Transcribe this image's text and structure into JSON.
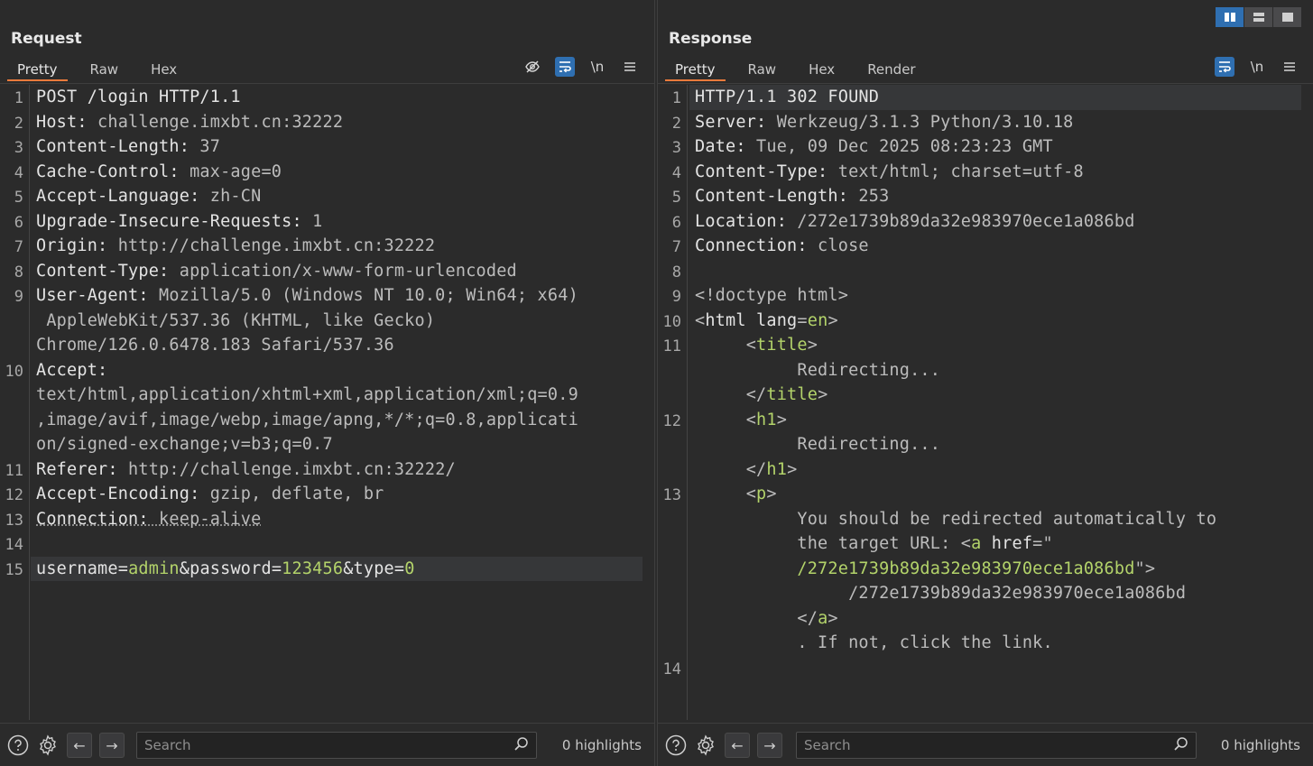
{
  "request": {
    "title": "Request",
    "tabs": [
      "Pretty",
      "Raw",
      "Hex"
    ],
    "tools": [
      "eye-slash-icon",
      "wrap-icon",
      "\\n",
      "menu-icon"
    ],
    "lines": [
      {
        "n": "1",
        "segs": [
          [
            "POST /login HTTP/1.1",
            "k"
          ]
        ]
      },
      {
        "n": "2",
        "segs": [
          [
            "Host:",
            "k"
          ],
          [
            " challenge.imxbt.cn:32222",
            "v"
          ]
        ]
      },
      {
        "n": "3",
        "segs": [
          [
            "Content-Length:",
            "k"
          ],
          [
            " 37",
            "v"
          ]
        ]
      },
      {
        "n": "4",
        "segs": [
          [
            "Cache-Control:",
            "k"
          ],
          [
            " max-age=0",
            "v"
          ]
        ]
      },
      {
        "n": "5",
        "segs": [
          [
            "Accept-Language:",
            "k"
          ],
          [
            " zh-CN",
            "v"
          ]
        ]
      },
      {
        "n": "6",
        "segs": [
          [
            "Upgrade-Insecure-Requests:",
            "k"
          ],
          [
            " 1",
            "v"
          ]
        ]
      },
      {
        "n": "7",
        "segs": [
          [
            "Origin:",
            "k"
          ],
          [
            " http://challenge.imxbt.cn:32222",
            "v"
          ]
        ]
      },
      {
        "n": "8",
        "segs": [
          [
            "Content-Type:",
            "k"
          ],
          [
            " application/x-www-form-urlencoded",
            "v"
          ]
        ]
      },
      {
        "n": "9",
        "segs": [
          [
            "User-Agent:",
            "k"
          ],
          [
            " Mozilla/5.0 (Windows NT 10.0; Win64; x64)",
            "v"
          ]
        ]
      },
      {
        "n": "",
        "segs": [
          [
            " AppleWebKit/537.36 (KHTML, like Gecko)",
            "v"
          ]
        ]
      },
      {
        "n": "",
        "segs": [
          [
            "Chrome/126.0.6478.183 Safari/537.36",
            "v"
          ]
        ]
      },
      {
        "n": "10",
        "segs": [
          [
            "Accept:",
            "k"
          ]
        ]
      },
      {
        "n": "",
        "segs": [
          [
            "text/html,application/xhtml+xml,application/xml;q=0.9",
            "v"
          ]
        ]
      },
      {
        "n": "",
        "segs": [
          [
            ",image/avif,image/webp,image/apng,*/*;q=0.8,applicati",
            "v"
          ]
        ]
      },
      {
        "n": "",
        "segs": [
          [
            "on/signed-exchange;v=b3;q=0.7",
            "v"
          ]
        ]
      },
      {
        "n": "11",
        "segs": [
          [
            "Referer:",
            "k"
          ],
          [
            " http://challenge.imxbt.cn:32222/",
            "v"
          ]
        ]
      },
      {
        "n": "12",
        "segs": [
          [
            "Accept-Encoding:",
            "k"
          ],
          [
            " gzip, deflate, br",
            "v"
          ]
        ]
      },
      {
        "n": "13",
        "segs": [
          [
            "Connection:",
            "k dot"
          ],
          [
            " keep-alive",
            "v dot"
          ]
        ]
      },
      {
        "n": "14",
        "segs": []
      },
      {
        "n": "15",
        "hl": true,
        "segs": [
          [
            "username",
            "k"
          ],
          [
            "=",
            "k"
          ],
          [
            "admin",
            "g"
          ],
          [
            "&",
            "k"
          ],
          [
            "password",
            "k"
          ],
          [
            "=",
            "k"
          ],
          [
            "123456",
            "g"
          ],
          [
            "&",
            "k"
          ],
          [
            "type",
            "k"
          ],
          [
            "=",
            "k"
          ],
          [
            "0",
            "g"
          ]
        ]
      }
    ],
    "search_placeholder": "Search",
    "highlights": "0 highlights"
  },
  "response": {
    "title": "Response",
    "tabs": [
      "Pretty",
      "Raw",
      "Hex",
      "Render"
    ],
    "tools": [
      "wrap-icon",
      "\\n",
      "menu-icon"
    ],
    "lines": [
      {
        "n": "1",
        "hl": true,
        "segs": [
          [
            "HTTP/1.1 302 FOUND",
            "k"
          ]
        ]
      },
      {
        "n": "2",
        "segs": [
          [
            "Server:",
            "k"
          ],
          [
            " Werkzeug/3.1.3 Python/3.10.18",
            "v"
          ]
        ]
      },
      {
        "n": "3",
        "segs": [
          [
            "Date:",
            "k"
          ],
          [
            " Tue, 09 Dec 2025 08:23:23 GMT",
            "v"
          ]
        ]
      },
      {
        "n": "4",
        "segs": [
          [
            "Content-Type:",
            "k"
          ],
          [
            " text/html; charset=utf-8",
            "v"
          ]
        ]
      },
      {
        "n": "5",
        "segs": [
          [
            "Content-Length:",
            "k"
          ],
          [
            " 253",
            "v"
          ]
        ]
      },
      {
        "n": "6",
        "segs": [
          [
            "Location:",
            "k"
          ],
          [
            " /272e1739b89da32e983970ece1a086bd",
            "v"
          ]
        ]
      },
      {
        "n": "7",
        "segs": [
          [
            "Connection:",
            "k"
          ],
          [
            " close",
            "v"
          ]
        ]
      },
      {
        "n": "8",
        "segs": []
      },
      {
        "n": "9",
        "segs": [
          [
            "<!doctype html>",
            "v"
          ]
        ]
      },
      {
        "n": "10",
        "segs": [
          [
            "<",
            "v"
          ],
          [
            "html",
            "k"
          ],
          [
            " lang",
            "k"
          ],
          [
            "=",
            "v"
          ],
          [
            "en",
            "g"
          ],
          [
            ">",
            "v"
          ]
        ]
      },
      {
        "n": "11",
        "segs": [
          [
            "     <",
            "v"
          ],
          [
            "title",
            "g"
          ],
          [
            ">",
            "v"
          ]
        ]
      },
      {
        "n": "",
        "segs": [
          [
            "          Redirecting...",
            "v"
          ]
        ]
      },
      {
        "n": "",
        "segs": [
          [
            "     </",
            "v"
          ],
          [
            "title",
            "g"
          ],
          [
            ">",
            "v"
          ]
        ]
      },
      {
        "n": "12",
        "segs": [
          [
            "     <",
            "v"
          ],
          [
            "h1",
            "g"
          ],
          [
            ">",
            "v"
          ]
        ]
      },
      {
        "n": "",
        "segs": [
          [
            "          Redirecting...",
            "v"
          ]
        ]
      },
      {
        "n": "",
        "segs": [
          [
            "     </",
            "v"
          ],
          [
            "h1",
            "g"
          ],
          [
            ">",
            "v"
          ]
        ]
      },
      {
        "n": "13",
        "segs": [
          [
            "     <",
            "v"
          ],
          [
            "p",
            "g"
          ],
          [
            ">",
            "v"
          ]
        ]
      },
      {
        "n": "",
        "segs": [
          [
            "          You should be redirected automatically to",
            "v"
          ]
        ]
      },
      {
        "n": "",
        "segs": [
          [
            "          the target URL: <",
            "v"
          ],
          [
            "a",
            "g"
          ],
          [
            " href",
            "k"
          ],
          [
            "=\"",
            "v"
          ]
        ]
      },
      {
        "n": "",
        "segs": [
          [
            "          /272e1739b89da32e983970ece1a086bd",
            "g"
          ],
          [
            "\">",
            "v"
          ]
        ]
      },
      {
        "n": "",
        "segs": [
          [
            "               /272e1739b89da32e983970ece1a086bd",
            "v"
          ]
        ]
      },
      {
        "n": "",
        "segs": [
          [
            "          </",
            "v"
          ],
          [
            "a",
            "g"
          ],
          [
            ">",
            "v"
          ]
        ]
      },
      {
        "n": "",
        "segs": [
          [
            "          . If not, click the link.",
            "v"
          ]
        ]
      },
      {
        "n": "14",
        "segs": []
      }
    ],
    "search_placeholder": "Search",
    "highlights": "0 highlights"
  },
  "layout_buttons": [
    "split-vertical-icon",
    "split-horizontal-icon",
    "single-pane-icon"
  ]
}
